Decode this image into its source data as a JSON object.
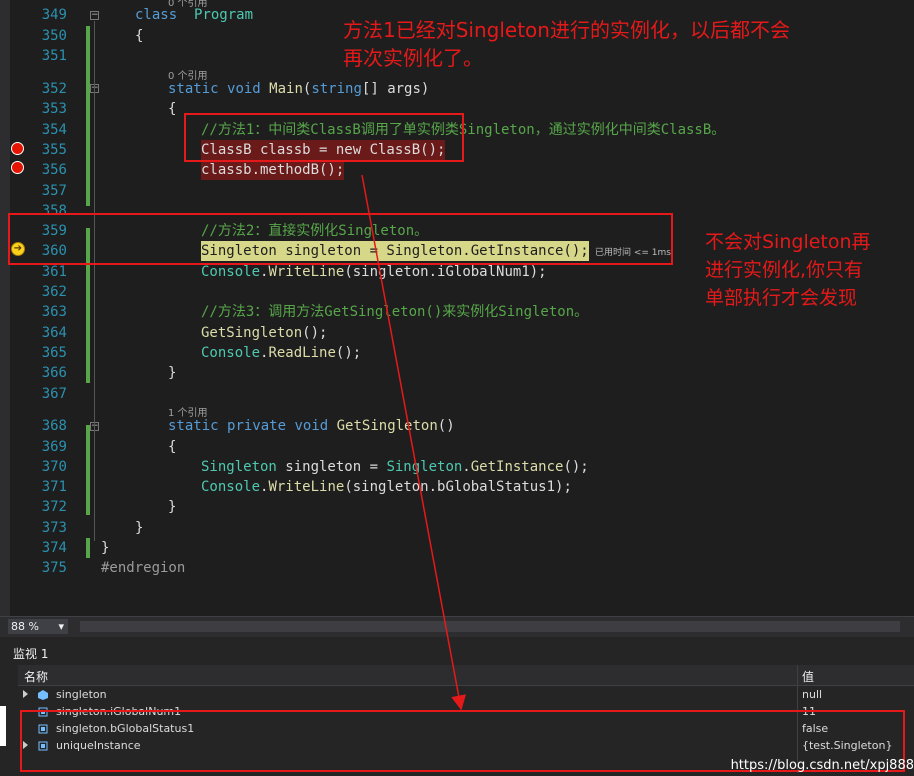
{
  "editor": {
    "codelens_main": "0 个引用",
    "codelens_get": "1 个引用",
    "codelens_top": "0 个引用",
    "lines": [
      {
        "num": "349",
        "tokens": [
          [
            "k",
            "class"
          ],
          [
            "",
            "  "
          ],
          [
            "t",
            "Program"
          ]
        ],
        "indent": 34
      },
      {
        "num": "350",
        "tokens": [
          [
            "",
            "{"
          ]
        ],
        "indent": 34
      },
      {
        "num": "351",
        "tokens": [],
        "indent": 0
      },
      {
        "num": "352",
        "tokens": [
          [
            "k",
            "static"
          ],
          [
            "",
            " "
          ],
          [
            "k",
            "void"
          ],
          [
            "",
            " "
          ],
          [
            "m",
            "Main"
          ],
          [
            "",
            "("
          ],
          [
            "k",
            "string"
          ],
          [
            "",
            "[] args)"
          ]
        ],
        "indent": 67
      },
      {
        "num": "353",
        "tokens": [
          [
            "",
            "{"
          ]
        ],
        "indent": 67
      },
      {
        "num": "354",
        "tokens": [
          [
            "c",
            "//方法1：中间类ClassB调用了单实例类Singleton，通过实例化中间类ClassB。"
          ]
        ],
        "indent": 100
      },
      {
        "num": "355",
        "tokens": [
          [
            "",
            "ClassB classb = new ClassB();"
          ]
        ],
        "indent": 100,
        "hl": "bp"
      },
      {
        "num": "356",
        "tokens": [
          [
            "",
            "classb.methodB();"
          ]
        ],
        "indent": 100,
        "hl": "bp"
      },
      {
        "num": "357",
        "tokens": [],
        "indent": 0
      },
      {
        "num": "358",
        "tokens": [],
        "indent": 0
      },
      {
        "num": "359",
        "tokens": [
          [
            "c",
            "//方法2：直接实例化Singleton。"
          ]
        ],
        "indent": 100
      },
      {
        "num": "360",
        "tokens": [
          [
            "",
            "Singleton singleton = Singleton.GetInstance();"
          ]
        ],
        "indent": 100,
        "hl": "cur"
      },
      {
        "num": "361",
        "tokens": [
          [
            "t",
            "Console"
          ],
          [
            "",
            "."
          ],
          [
            "m",
            "WriteLine"
          ],
          [
            "",
            "(singleton.iGlobalNum1);"
          ]
        ],
        "indent": 100
      },
      {
        "num": "362",
        "tokens": [],
        "indent": 0
      },
      {
        "num": "363",
        "tokens": [
          [
            "c",
            "//方法3：调用方法GetSingleton()来实例化Singleton。"
          ]
        ],
        "indent": 100
      },
      {
        "num": "364",
        "tokens": [
          [
            "m",
            "GetSingleton"
          ],
          [
            "",
            "();"
          ]
        ],
        "indent": 100
      },
      {
        "num": "365",
        "tokens": [
          [
            "t",
            "Console"
          ],
          [
            "",
            "."
          ],
          [
            "m",
            "ReadLine"
          ],
          [
            "",
            "();"
          ]
        ],
        "indent": 100
      },
      {
        "num": "366",
        "tokens": [
          [
            "",
            "}"
          ]
        ],
        "indent": 67
      },
      {
        "num": "367",
        "tokens": [],
        "indent": 0
      },
      {
        "num": "368",
        "tokens": [
          [
            "k",
            "static"
          ],
          [
            "",
            " "
          ],
          [
            "k",
            "private"
          ],
          [
            "",
            " "
          ],
          [
            "k",
            "void"
          ],
          [
            "",
            " "
          ],
          [
            "m",
            "GetSingleton"
          ],
          [
            "",
            "()"
          ]
        ],
        "indent": 67
      },
      {
        "num": "369",
        "tokens": [
          [
            "",
            "{"
          ]
        ],
        "indent": 67
      },
      {
        "num": "370",
        "tokens": [
          [
            "t",
            "Singleton"
          ],
          [
            "",
            " singleton = "
          ],
          [
            "t",
            "Singleton"
          ],
          [
            "",
            "."
          ],
          [
            "m",
            "GetInstance"
          ],
          [
            "",
            "();"
          ]
        ],
        "indent": 100
      },
      {
        "num": "371",
        "tokens": [
          [
            "t",
            "Console"
          ],
          [
            "",
            "."
          ],
          [
            "m",
            "WriteLine"
          ],
          [
            "",
            "(singleton.bGlobalStatus1);"
          ]
        ],
        "indent": 100
      },
      {
        "num": "372",
        "tokens": [
          [
            "",
            "}"
          ]
        ],
        "indent": 67
      },
      {
        "num": "373",
        "tokens": [
          [
            "",
            "}"
          ]
        ],
        "indent": 34
      },
      {
        "num": "374",
        "tokens": [
          [
            "",
            "}"
          ]
        ],
        "indent": 0
      },
      {
        "num": "375",
        "tokens": [
          [
            "p",
            "#endregion"
          ]
        ],
        "indent": 0
      }
    ],
    "elapsed": "已用时间 <= 1ms"
  },
  "annotations": {
    "top": [
      "方法1已经对Singleton进行的实例化，以后都不会",
      "再次实例化了。"
    ],
    "right": [
      "不会对Singleton再",
      "进行实例化,你只有",
      "单部执行才会发现"
    ]
  },
  "zoom": {
    "value": "88 %"
  },
  "watch": {
    "title": "监视 1",
    "col_name": "名称",
    "col_value": "值",
    "rows": [
      {
        "name": "singleton",
        "value": "null",
        "expandable": true
      },
      {
        "name": "singleton.iGlobalNum1",
        "value": "11",
        "expandable": false
      },
      {
        "name": "singleton.bGlobalStatus1",
        "value": "false",
        "expandable": false
      },
      {
        "name": "uniqueInstance",
        "value": "{test.Singleton}",
        "expandable": true
      }
    ]
  },
  "watermark": "https://blog.csdn.net/xpj888",
  "colors": {
    "annotation": "#e51919",
    "breakpoint": "#e51400",
    "current_line": "#d7d78a"
  }
}
